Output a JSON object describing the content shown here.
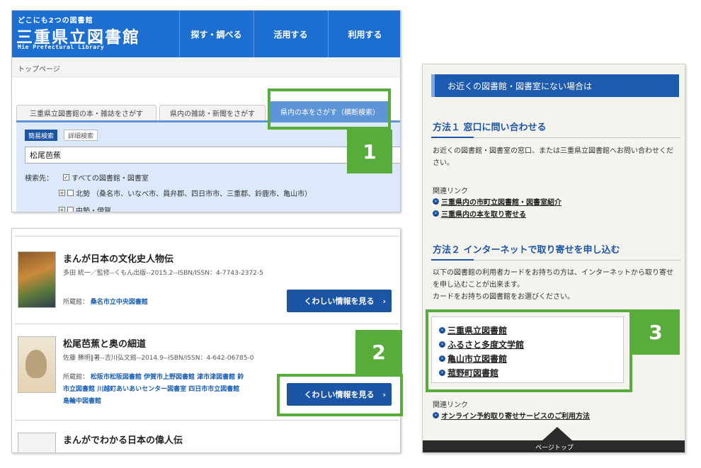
{
  "header": {
    "tagline": "どこにも2つの図書館",
    "logo": "三重県立図書館",
    "logo_en": "Mie Prefectural Library",
    "nav": [
      "探す・調べる",
      "活用する",
      "利用する"
    ],
    "breadcrumb": "トップページ"
  },
  "search": {
    "tabs": [
      "三重県立図書館の本・雑誌をさがす",
      "県内の雑誌・新聞をさがす",
      "県内の本をさがす（横断検索）"
    ],
    "modes": [
      "簡易検索",
      "詳細検索"
    ],
    "query": "松尾芭蕉",
    "target_label": "検索先：",
    "all_libraries": "すべての図書館・図書室",
    "region_north": "北勢 （桑名市、いなべ市、員弁郡、四日市市、三重郡、鈴鹿市、亀山市）",
    "region_mid": "中勢・伊賀",
    "all_checked": true
  },
  "results": [
    {
      "title": "まんが日本の文化史人物伝",
      "meta": "多田 統一／監修--くもん出版--2015.2--ISBN/ISSN：4-7743-2372-5",
      "holdings_label": "所蔵館：",
      "holdings": "桑名市立中央図書館"
    },
    {
      "title": "松尾芭蕉と奥の細道",
      "meta": "佐藤 勝明‖著--吉川弘文館--2014.9--ISBN/ISSN：4-642-06785-0",
      "holdings_label": "所蔵館：",
      "holdings_lines": [
        "松阪市松阪図書館 伊賀市上野図書館 津市津図書館 鈴",
        "市立図書館 川越町あいあいセンター図書室 四日市市立図書館",
        "島輪中図書館"
      ]
    },
    {
      "title": "まんがでわかる日本の偉人伝"
    }
  ],
  "more_button": "くわしい情報を見る",
  "sidebar": {
    "banner": "お近くの図書館・図書室にない場合は",
    "method1_title": "方法１ 窓口に問い合わせる",
    "method1_text": "お近くの図書館・図書室の窓口、または三重県立図書館へお問い合わせください。",
    "related_label": "関連リンク",
    "method1_links": [
      "三重県内の市町立図書館・図書室紹介",
      "三重県内の本を取り寄せる"
    ],
    "method2_title": "方法２ インターネットで取り寄せを申し込む",
    "method2_text": "以下の図書館の利用者カードをお持ちの方は、インターネットから取り寄せを申し込むことが出来ます。",
    "method2_text2": "カードをお持ちの図書館をお選びください。",
    "libraries": [
      "三重県立図書館",
      "ふるさと多度文学館",
      "亀山市立図書館",
      "菰野町図書館"
    ],
    "method2_link": "オンライン予約取り寄せサービスのご利用方法",
    "page_top": "ページトップ"
  },
  "callouts": [
    "1",
    "2",
    "3"
  ],
  "colors": {
    "brand_blue": "#1c6fd1",
    "button_blue": "#1d55a6",
    "callout_green": "#57ac3b"
  }
}
